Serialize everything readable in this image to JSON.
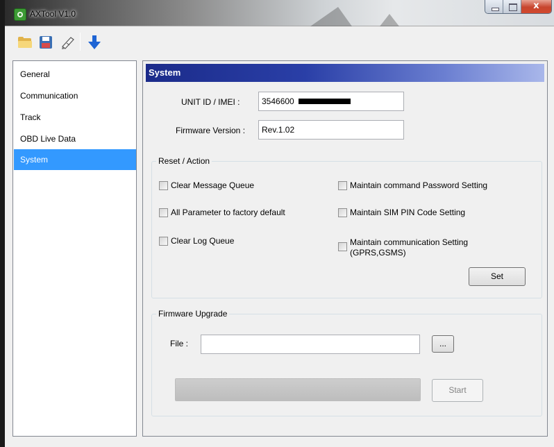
{
  "window": {
    "title": "AXTool V1.0",
    "close_glyph": "x"
  },
  "toolbar": {
    "icons": [
      "open-folder-icon",
      "save-icon",
      "write-icon",
      "download-arrow-icon"
    ]
  },
  "sidebar": {
    "items": [
      {
        "label": "General"
      },
      {
        "label": "Communication"
      },
      {
        "label": "Track"
      },
      {
        "label": "OBD Live Data"
      },
      {
        "label": "System"
      }
    ],
    "selected": "System",
    "selected_color": "#3399ff"
  },
  "main": {
    "header": "System",
    "unit_id_label": "UNIT ID / IMEI :",
    "unit_id_value": "3546600",
    "firmware_label": "Firmware Version :",
    "firmware_value": "Rev.1.02",
    "reset_group": {
      "title": "Reset / Action",
      "options": {
        "clear_message_queue": "Clear Message Queue",
        "factory_default": "All Parameter to factory default",
        "clear_log_queue": "Clear Log Queue",
        "maintain_password": "Maintain command Password Setting",
        "maintain_sim_pin": "Maintain SIM PIN Code Setting",
        "maintain_comm_line1": "Maintain communication Setting",
        "maintain_comm_line2": "(GPRS,GSMS)"
      },
      "set_button": "Set"
    },
    "firmware_group": {
      "title": "Firmware Upgrade",
      "file_label": "File :",
      "file_value": "",
      "browse_button": "...",
      "progress": 0,
      "start_button": "Start"
    }
  }
}
